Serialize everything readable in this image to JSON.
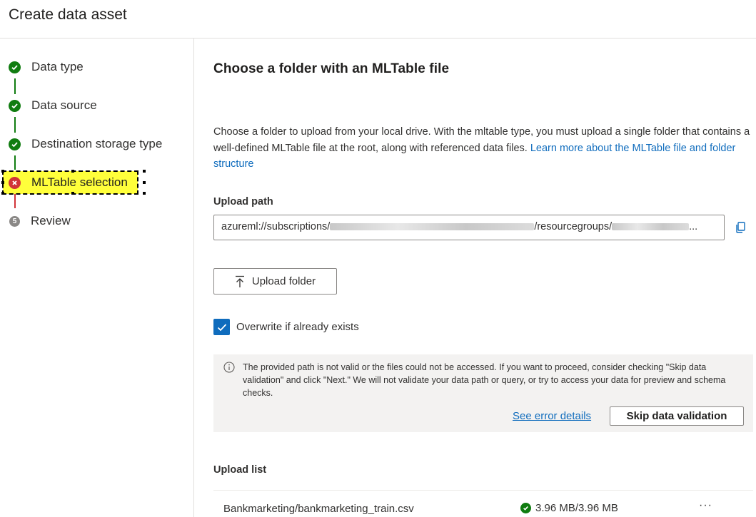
{
  "header": {
    "title": "Create data asset"
  },
  "steps": [
    {
      "label": "Data type",
      "status": "done"
    },
    {
      "label": "Data source",
      "status": "done"
    },
    {
      "label": "Destination storage type",
      "status": "done"
    },
    {
      "label": "MLTable selection",
      "status": "error"
    },
    {
      "label": "Review",
      "status": "pending",
      "number": "5"
    }
  ],
  "main": {
    "title": "Choose a folder with an MLTable file",
    "description": "Choose a folder to upload from your local drive. With the mltable type, you must upload a single folder that contains a well-defined MLTable file at the root, along with referenced data files. ",
    "learn_more_link": "Learn more about the MLTable file and folder structure",
    "upload_path_label": "Upload path",
    "upload_path_prefix": "azureml://subscriptions/",
    "upload_path_middle": "/resourcegroups/",
    "upload_path_suffix": "...",
    "upload_button": "Upload folder",
    "overwrite_label": "Overwrite if already exists",
    "overwrite_checked": true
  },
  "message": {
    "text": "The provided path is not valid or the files could not be accessed. If you want to proceed, consider checking \"Skip data validation\" and click \"Next.\" We will not validate your data path or query, or try to access your data for preview and schema checks.",
    "see_error_link": "See error details",
    "skip_button": "Skip data validation"
  },
  "upload_list": {
    "title": "Upload list",
    "files": [
      {
        "name": "Bankmarketing/bankmarketing_train.csv",
        "status": "3.96 MB/3.96 MB"
      }
    ]
  },
  "colors": {
    "accent": "#0f6cbd",
    "success": "#107c10",
    "error": "#d13438",
    "highlight": "#ffff3b"
  }
}
